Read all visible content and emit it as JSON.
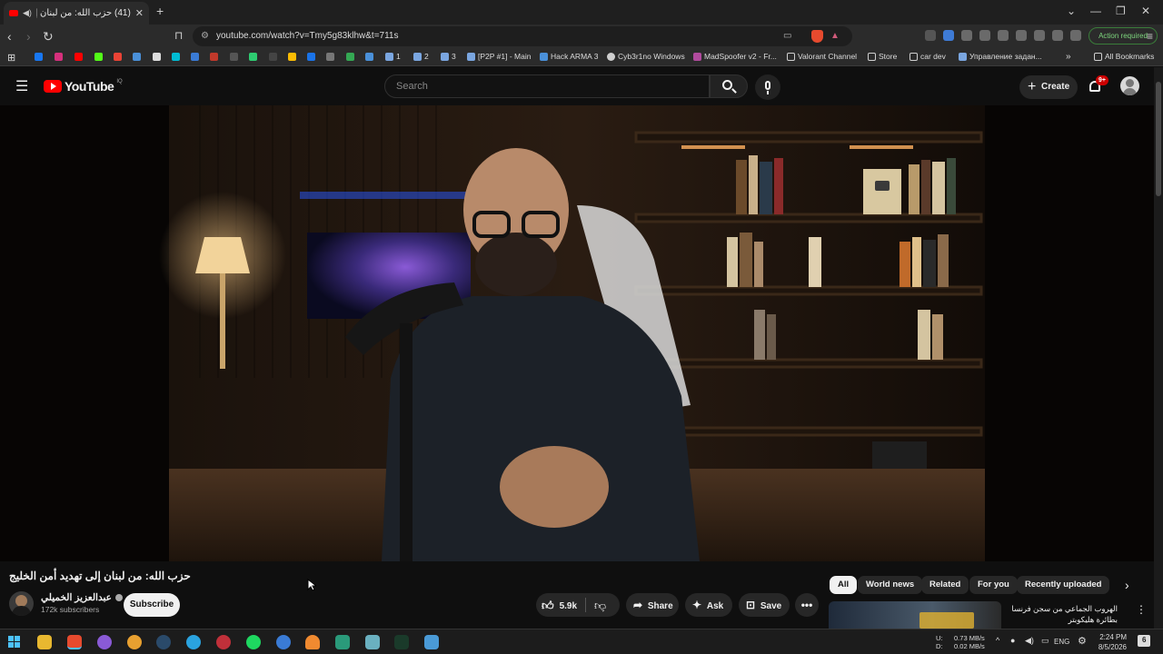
{
  "browser": {
    "tab_title": "(41) حزب الله: من لبنان إلى تهد",
    "url": "youtube.com/watch?v=Tmy5g83klhw&t=711s",
    "action_required": "Action required",
    "all_bookmarks": "All Bookmarks",
    "bookmarks": [
      {
        "label": "1",
        "color": "#7aa6e0"
      },
      {
        "label": "2",
        "color": "#7aa6e0"
      },
      {
        "label": "3",
        "color": "#7aa6e0"
      },
      {
        "label": "[P2P #1] - Main",
        "color": "#7aa6e0"
      },
      {
        "label": "Hack ARMA 3",
        "color": "#4a90d9"
      },
      {
        "label": "Cyb3r1no Windows",
        "color": "#cfcfcf"
      },
      {
        "label": "MadSpoofer v2 - Fr...",
        "color": "#b14b9e"
      },
      {
        "label": "Valorant Channel",
        "color": "#cfcfcf"
      },
      {
        "label": "Store",
        "color": "#cfcfcf"
      },
      {
        "label": "car dev",
        "color": "#cfcfcf"
      },
      {
        "label": "Управление задан...",
        "color": "#7aa6e0"
      }
    ]
  },
  "youtube": {
    "logo_text": "YouTube",
    "logo_region": "IQ",
    "search_placeholder": "Search",
    "create_label": "Create",
    "notifications_badge": "9+"
  },
  "video": {
    "title": "حزب الله: من لبنان إلى تهديد أمن الخليج",
    "channel_name": "عبدالعزيز الخميلي",
    "subscribers": "172k subscribers",
    "subscribe_label": "Subscribe",
    "likes": "5.9k",
    "share_label": "Share",
    "ask_label": "Ask",
    "save_label": "Save"
  },
  "filters": {
    "chips": [
      "All",
      "World news",
      "Related",
      "For you",
      "Recently uploaded"
    ]
  },
  "recommendation": {
    "title": "الهروب الجماعي من سجن فرنسا بطائرة هليكوبتر"
  },
  "taskbar": {
    "net_up": "0.73 MB/s",
    "net_down": "0.02 MB/s",
    "up_label": "U:",
    "down_label": "D:",
    "language": "ENG",
    "time": "2:24 PM",
    "date": "8/5/2026",
    "notification_count": "6"
  },
  "colors": {
    "youtube_red": "#ff0000",
    "background": "#0f0f0f",
    "chip_bg": "#272727"
  }
}
